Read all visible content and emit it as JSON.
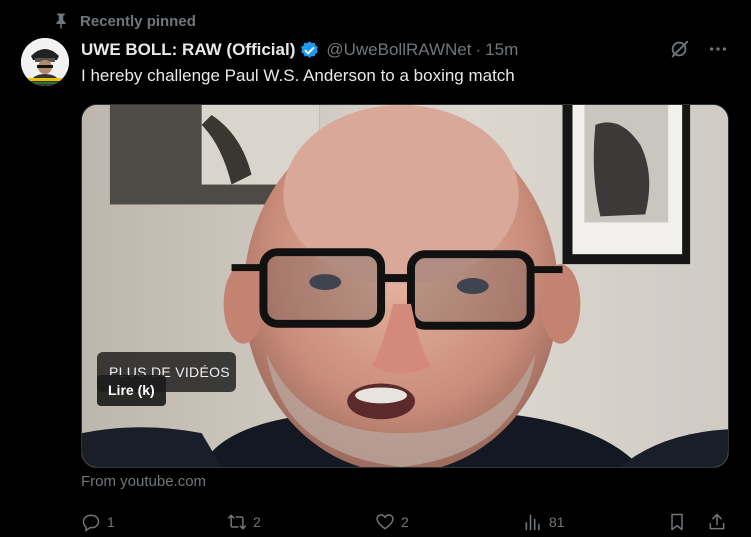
{
  "pinned": {
    "label": "Recently pinned"
  },
  "tweet": {
    "author_name": "UWE BOLL: RAW (Official)",
    "handle": "@UweBollRAWNet",
    "separator": "·",
    "time": "15m",
    "text": "I hereby challenge Paul W.S. Anderson to a boxing match"
  },
  "media": {
    "more_videos_label": "PLUS DE VIDÉOS",
    "play_tooltip": "Lire (k)"
  },
  "source": "From youtube.com",
  "actions": {
    "replies": "1",
    "reposts": "2",
    "likes": "2",
    "views": "81"
  },
  "colors": {
    "background": "#000000",
    "text": "#e7e9ea",
    "muted": "#71767b",
    "verified": "#1d9bf0"
  },
  "icons": {
    "pin": "pin-icon",
    "verified": "verified-badge-icon",
    "grok": "grok-icon",
    "more": "more-icon",
    "reply": "reply-icon",
    "repost": "repost-icon",
    "like": "heart-icon",
    "views": "views-icon",
    "bookmark": "bookmark-icon",
    "share": "share-icon"
  }
}
